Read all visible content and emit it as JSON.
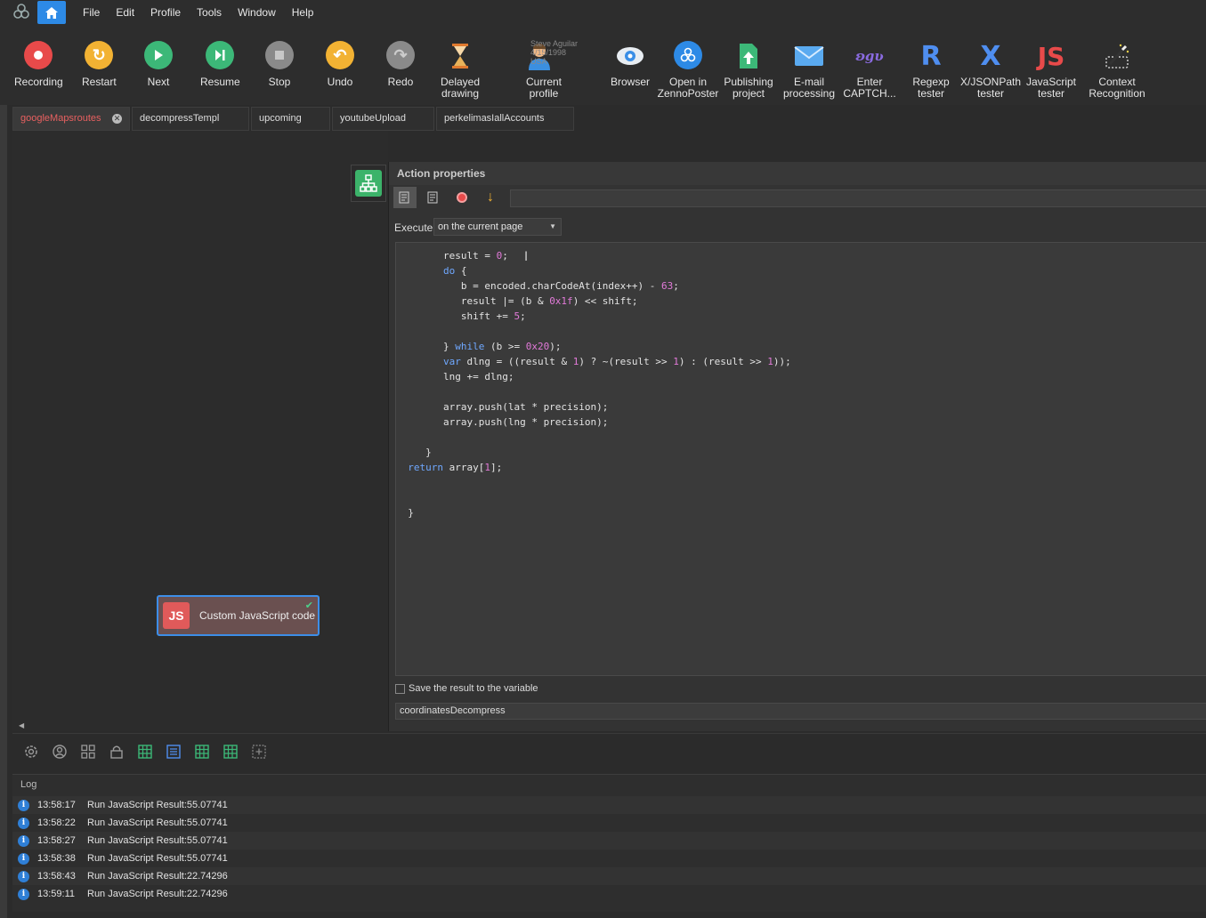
{
  "menu": {
    "items": [
      "File",
      "Edit",
      "Profile",
      "Tools",
      "Window",
      "Help"
    ]
  },
  "toolbar": {
    "recording": "Recording",
    "restart": "Restart",
    "next": "Next",
    "resume": "Resume",
    "stop": "Stop",
    "undo": "Undo",
    "redo": "Redo",
    "delayed_drawing": "Delayed drawing",
    "current_profile": "Current profile",
    "profile_name": "Steve Aguilar",
    "profile_date": "4/15/1998",
    "profile_country": "USA",
    "browser": "Browser",
    "open_zennoposter": "Open in ZennoPoster",
    "publishing_project": "Publishing project",
    "email_processing": "E-mail processing",
    "enter_captcha": "Enter CAPTCH...",
    "regexp_tester": "Regexp tester",
    "xjsonpath_tester": "X/JSONPath tester",
    "javascript_tester": "JavaScript tester",
    "context_recognition": "Context Recognition"
  },
  "tabs": [
    "googleMapsroutes",
    "decompressTempl",
    "upcoming",
    "youtubeUpload",
    "perkelimasIallAccounts"
  ],
  "node": {
    "icon_text": "JS",
    "label": "Custom JavaScript code"
  },
  "props": {
    "title": "Action properties",
    "execute_label": "Execute",
    "execute_value": "on the current page",
    "code_lines": [
      "        result = 0;",
      "        do {",
      "           b = encoded.charCodeAt(index++) - 63;",
      "           result |= (b & 0x1f) << shift;",
      "           shift += 5;",
      "",
      "        } while (b >= 0x20);",
      "        var dlng = ((result & 1) ? ~(result >> 1) : (result >> 1));",
      "        lng += dlng;",
      "",
      "        array.push(lat * precision);",
      "        array.push(lng * precision);",
      "",
      "     }",
      "  return array[1];",
      "",
      "",
      "  }"
    ],
    "save_label": "Save the result to the variable",
    "save_value": "coordinatesDecompress"
  },
  "log": {
    "title": "Log",
    "rows": [
      {
        "time": "13:58:17",
        "msg": "Run JavaScript  Result:55.07741"
      },
      {
        "time": "13:58:22",
        "msg": "Run JavaScript  Result:55.07741"
      },
      {
        "time": "13:58:27",
        "msg": "Run JavaScript  Result:55.07741"
      },
      {
        "time": "13:58:38",
        "msg": "Run JavaScript  Result:55.07741"
      },
      {
        "time": "13:58:43",
        "msg": "Run JavaScript  Result:22.74296"
      },
      {
        "time": "13:59:11",
        "msg": "Run JavaScript  Result:22.74296"
      }
    ]
  },
  "colors": {
    "accent": "#2d8ae6",
    "recording": "#e84a4a",
    "restart": "#f2b233",
    "next": "#3cb878",
    "node_border": "#3d8ee8"
  }
}
